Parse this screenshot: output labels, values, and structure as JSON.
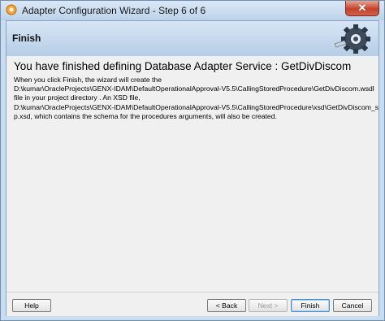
{
  "window": {
    "title": "Adapter Configuration Wizard - Step 6 of 6",
    "close_label": "✕"
  },
  "header": {
    "title": "Finish"
  },
  "content": {
    "headline": "You have finished defining Database Adapter Service : GetDivDiscom",
    "lines": [
      "When you click Finish, the wizard will create the",
      "D:\\kumar\\OracleProjects\\GENX-IDAM\\DefaultOperationalApproval-V5.5\\CallingStoredProcedure\\GetDivDiscom.wsdl",
      "file in your project directory . An XSD file,",
      "D:\\kumar\\OracleProjects\\GENX-IDAM\\DefaultOperationalApproval-V5.5\\CallingStoredProcedure\\xsd\\GetDivDiscom_s",
      "p.xsd, which contains the schema for the procedures arguments, will also be created."
    ]
  },
  "buttons": {
    "help": "Help",
    "back": "< Back",
    "next": "Next >",
    "finish": "Finish",
    "cancel": "Cancel"
  }
}
